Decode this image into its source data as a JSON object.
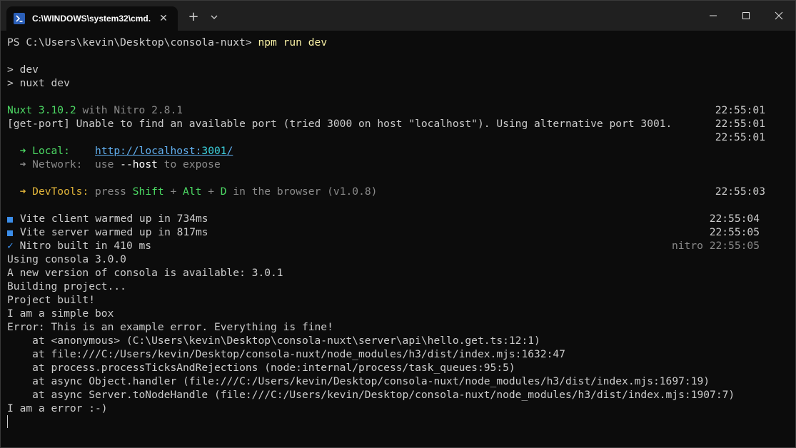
{
  "window": {
    "tab_title": "C:\\WINDOWS\\system32\\cmd.",
    "tab_close": "✕",
    "new_tab": "+",
    "dropdown": "⌄",
    "min": "—",
    "max": "☐",
    "close": "✕"
  },
  "terminal": {
    "prompt": "PS C:\\Users\\kevin\\Desktop\\consola-nuxt> ",
    "command": "npm run dev",
    "l_dev": "> dev",
    "l_nuxtdev": "> nuxt dev",
    "nuxt_ver": "Nuxt 3.10.2",
    "nitro_ver": " with Nitro 2.8.1",
    "getport": "[get-port] Unable to find an available port (tried 3000 on host \"localhost\"). Using alternative port 3001.",
    "ts_1": "22:55:01",
    "ts_2": "22:55:01",
    "ts_3": "22:55:01",
    "local_arrow": "  ➜ ",
    "local_label": "Local:",
    "local_url_a": "http://localhost:",
    "local_url_b": "3001",
    "local_url_c": "/",
    "network_label": "  ➜ Network:  ",
    "network_use": "use ",
    "network_host": "--host",
    "network_tail": " to expose",
    "devtools_arrow": "  ➜ ",
    "devtools_label": "DevTools:",
    "devtools_press": " press ",
    "devtools_shift": "Shift",
    "devtools_plus1": " + ",
    "devtools_alt": "Alt",
    "devtools_plus2": " + ",
    "devtools_d": "D",
    "devtools_tail": " in the browser (v1.0.8)",
    "ts_4": "22:55:03",
    "vite_client": "Vite client warmed up in 734ms",
    "ts_5": "22:55:04",
    "vite_server": "Vite server warmed up in 817ms",
    "ts_6": "22:55:05",
    "nitro_built_check": "✓",
    "nitro_built": " Nitro built in 410 ms",
    "ts_7": "nitro 22:55:05",
    "l_using": "Using consola 3.0.0",
    "l_newver": "A new version of consola is available: 3.0.1",
    "l_building": "Building project...",
    "l_built": "Project built!",
    "l_box": "I am a simple box",
    "l_error": "Error: This is an example error. Everything is fine!",
    "l_at1": "    at <anonymous> (C:\\Users\\kevin\\Desktop\\consola-nuxt\\server\\api\\hello.get.ts:12:1)",
    "l_at2": "    at file:///C:/Users/kevin/Desktop/consola-nuxt/node_modules/h3/dist/index.mjs:1632:47",
    "l_at3": "    at process.processTicksAndRejections (node:internal/process/task_queues:95:5)",
    "l_at4": "    at async Object.handler (file:///C:/Users/kevin/Desktop/consola-nuxt/node_modules/h3/dist/index.mjs:1697:19)",
    "l_at5": "    at async Server.toNodeHandle (file:///C:/Users/kevin/Desktop/consola-nuxt/node_modules/h3/dist/index.mjs:1907:7)",
    "l_aerr": "I am a error :-)"
  }
}
